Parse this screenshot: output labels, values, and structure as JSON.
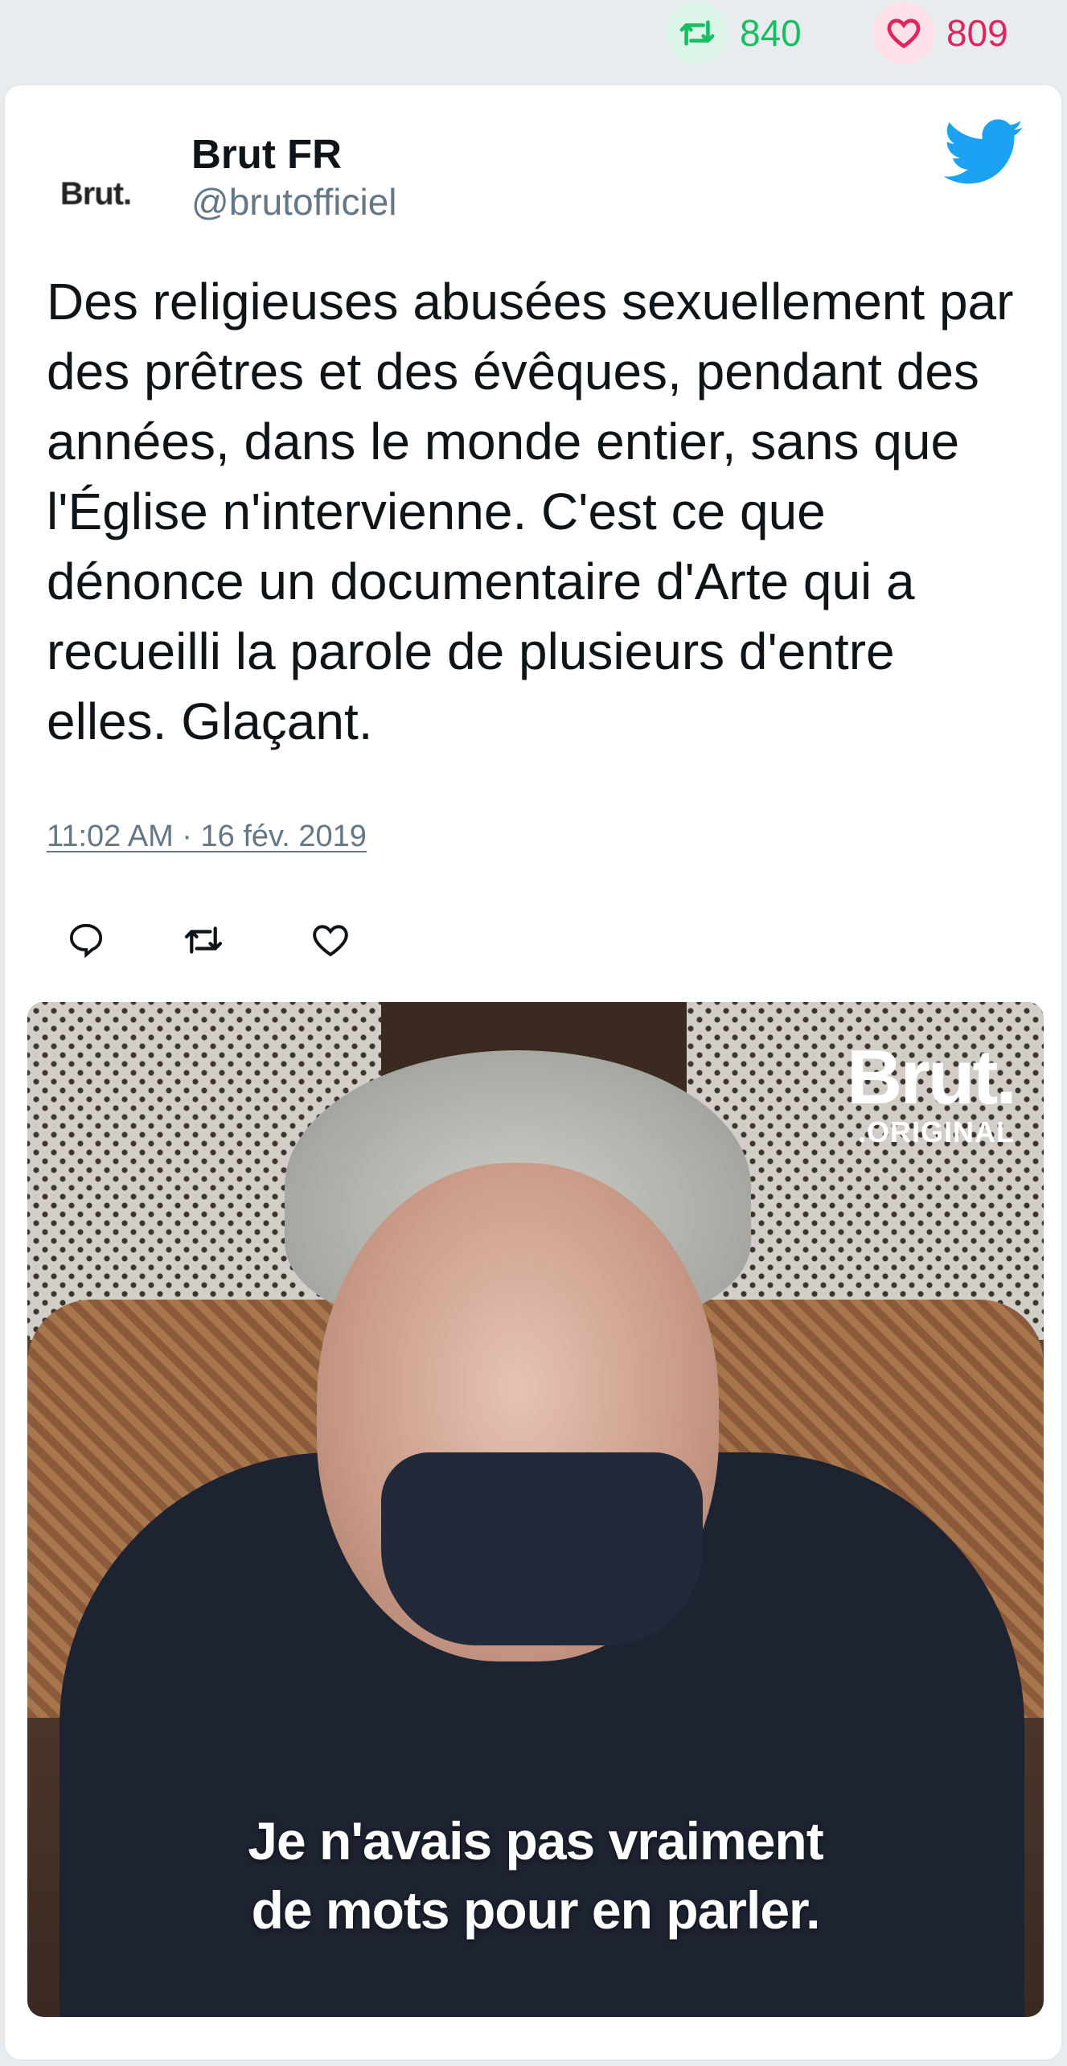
{
  "stats": {
    "retweets": "840",
    "likes": "809"
  },
  "tweet": {
    "author_name": "Brut FR",
    "author_handle": "@brutofficiel",
    "avatar_text": "Brut.",
    "text": "Des religieuses abusées sexuellement par des prêtres et des évêques, pendant des années, dans le monde entier, sans que l'Église n'intervienne. C'est ce que dénonce un documentaire d'Arte qui a recueilli la parole de plusieurs d'entre elles. Glaçant.",
    "timestamp": "11:02 AM · 16 fév. 2019"
  },
  "media": {
    "logo_main": "Brut.",
    "logo_sub": ".ORIGINAL",
    "caption_line1": "Je n'avais pas vraiment",
    "caption_line2": "de mots pour en parler."
  },
  "colors": {
    "retweet_green": "#17bf63",
    "like_red": "#e0245e",
    "twitter_blue": "#1da1f2",
    "muted_gray": "#657786"
  },
  "icons": [
    "retweet-icon",
    "heart-icon",
    "twitter-bird-icon",
    "reply-icon"
  ]
}
